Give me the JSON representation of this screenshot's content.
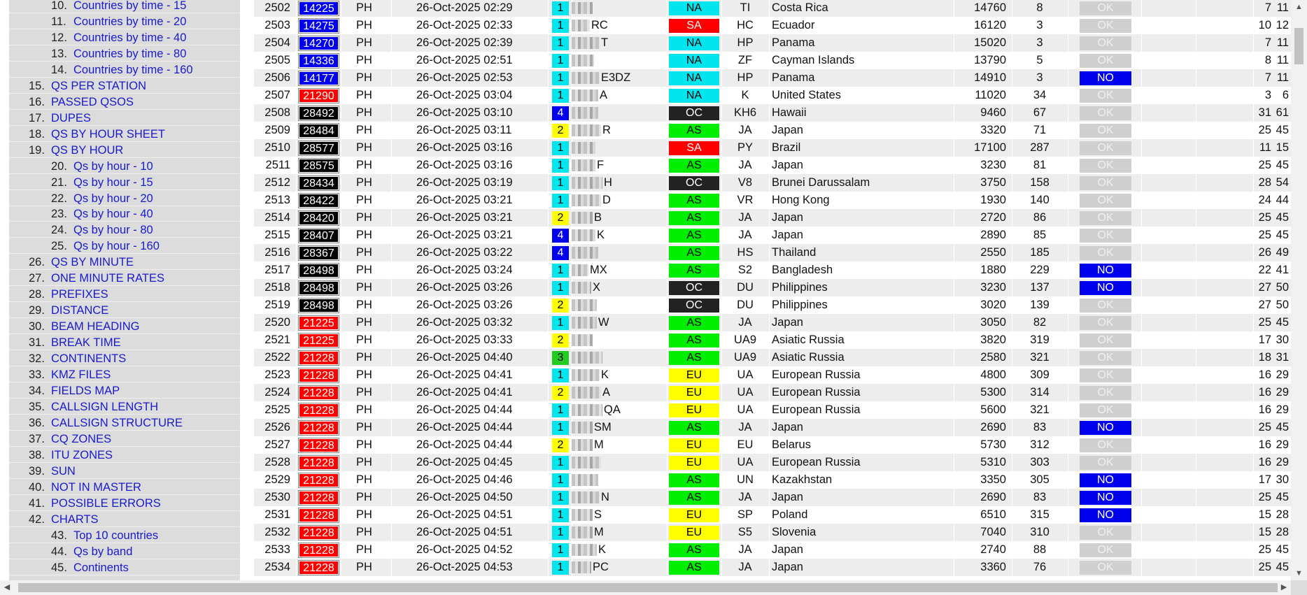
{
  "sidebar": {
    "items": [
      {
        "num": "10.",
        "label": "Countries by time - 15",
        "indent": true
      },
      {
        "num": "11.",
        "label": "Countries by time - 20",
        "indent": true
      },
      {
        "num": "12.",
        "label": "Countries by time - 40",
        "indent": true
      },
      {
        "num": "13.",
        "label": "Countries by time - 80",
        "indent": true
      },
      {
        "num": "14.",
        "label": "Countries by time - 160",
        "indent": true
      },
      {
        "num": "15.",
        "label": "QS PER STATION",
        "indent": false
      },
      {
        "num": "16.",
        "label": "PASSED QSOS",
        "indent": false
      },
      {
        "num": "17.",
        "label": "DUPES",
        "indent": false
      },
      {
        "num": "18.",
        "label": "QS BY HOUR SHEET",
        "indent": false
      },
      {
        "num": "19.",
        "label": "QS BY HOUR",
        "indent": false
      },
      {
        "num": "20.",
        "label": "Qs by hour - 10",
        "indent": true
      },
      {
        "num": "21.",
        "label": "Qs by hour - 15",
        "indent": true
      },
      {
        "num": "22.",
        "label": "Qs by hour - 20",
        "indent": true
      },
      {
        "num": "23.",
        "label": "Qs by hour - 40",
        "indent": true
      },
      {
        "num": "24.",
        "label": "Qs by hour - 80",
        "indent": true
      },
      {
        "num": "25.",
        "label": "Qs by hour - 160",
        "indent": true
      },
      {
        "num": "26.",
        "label": "QS BY MINUTE",
        "indent": false
      },
      {
        "num": "27.",
        "label": "ONE MINUTE RATES",
        "indent": false
      },
      {
        "num": "28.",
        "label": "PREFIXES",
        "indent": false
      },
      {
        "num": "29.",
        "label": "DISTANCE",
        "indent": false
      },
      {
        "num": "30.",
        "label": "BEAM HEADING",
        "indent": false
      },
      {
        "num": "31.",
        "label": "BREAK TIME",
        "indent": false
      },
      {
        "num": "32.",
        "label": "CONTINENTS",
        "indent": false
      },
      {
        "num": "33.",
        "label": "KMZ FILES",
        "indent": false
      },
      {
        "num": "34.",
        "label": "FIELDS MAP",
        "indent": false
      },
      {
        "num": "35.",
        "label": "CALLSIGN LENGTH",
        "indent": false
      },
      {
        "num": "36.",
        "label": "CALLSIGN STRUCTURE",
        "indent": false
      },
      {
        "num": "37.",
        "label": "CQ ZONES",
        "indent": false
      },
      {
        "num": "38.",
        "label": "ITU ZONES",
        "indent": false
      },
      {
        "num": "39.",
        "label": "SUN",
        "indent": false
      },
      {
        "num": "40.",
        "label": "NOT IN MASTER",
        "indent": false
      },
      {
        "num": "41.",
        "label": "POSSIBLE ERRORS",
        "indent": false
      },
      {
        "num": "42.",
        "label": "CHARTS",
        "indent": false
      },
      {
        "num": "43.",
        "label": "Top 10 countries",
        "indent": true
      },
      {
        "num": "44.",
        "label": "Qs by band",
        "indent": true
      },
      {
        "num": "45.",
        "label": "Continents",
        "indent": true
      }
    ]
  },
  "colors": {
    "tx": {
      "blue": "#0000ee",
      "red": "#ff0000",
      "black": "#000000"
    },
    "op": {
      "1": "#00e5ee",
      "2": "#ffff00",
      "3": "#22cc22",
      "4": "#0000ee"
    },
    "cont": {
      "NA": "#00e5ee",
      "SA": "#ff0000",
      "OC": "#222222",
      "AS": "#00ee00",
      "EU": "#ffff00"
    },
    "status": {
      "OK": "#cfcfcf",
      "NO": "#0000ee"
    }
  },
  "table": {
    "rows": [
      {
        "n": "2502",
        "freq": "14225",
        "txc": "blue",
        "mode": "PH",
        "dt": "26-Oct-2025 02:29",
        "op": "1",
        "call": "",
        "cont": "NA",
        "pfx": "TI",
        "country": "Costa Rica",
        "dist": "14760",
        "head": "8",
        "status": "OK",
        "cq": "7",
        "itu": "11"
      },
      {
        "n": "2503",
        "freq": "14275",
        "txc": "blue",
        "mode": "PH",
        "dt": "26-Oct-2025 02:33",
        "op": "1",
        "call": "RC",
        "cont": "SA",
        "pfx": "HC",
        "country": "Ecuador",
        "dist": "16120",
        "head": "3",
        "status": "OK",
        "cq": "10",
        "itu": "12"
      },
      {
        "n": "2504",
        "freq": "14270",
        "txc": "blue",
        "mode": "PH",
        "dt": "26-Oct-2025 02:39",
        "op": "1",
        "call": "T",
        "cont": "NA",
        "pfx": "HP",
        "country": "Panama",
        "dist": "15020",
        "head": "3",
        "status": "OK",
        "cq": "7",
        "itu": "11"
      },
      {
        "n": "2505",
        "freq": "14336",
        "txc": "blue",
        "mode": "PH",
        "dt": "26-Oct-2025 02:51",
        "op": "1",
        "call": "",
        "cont": "NA",
        "pfx": "ZF",
        "country": "Cayman Islands",
        "dist": "13790",
        "head": "5",
        "status": "OK",
        "cq": "8",
        "itu": "11"
      },
      {
        "n": "2506",
        "freq": "14177",
        "txc": "blue",
        "mode": "PH",
        "dt": "26-Oct-2025 02:53",
        "op": "1",
        "call": "E3DZ",
        "cont": "NA",
        "pfx": "HP",
        "country": "Panama",
        "dist": "14910",
        "head": "3",
        "status": "NO",
        "cq": "7",
        "itu": "11"
      },
      {
        "n": "2507",
        "freq": "21290",
        "txc": "red",
        "mode": "PH",
        "dt": "26-Oct-2025 03:04",
        "op": "1",
        "call": "A",
        "cont": "NA",
        "pfx": "K",
        "country": "United States",
        "dist": "11020",
        "head": "34",
        "status": "OK",
        "cq": "3",
        "itu": "6"
      },
      {
        "n": "2508",
        "freq": "28492",
        "txc": "black",
        "mode": "PH",
        "dt": "26-Oct-2025 03:10",
        "op": "4",
        "call": "",
        "cont": "OC",
        "pfx": "KH6",
        "country": "Hawaii",
        "dist": "9460",
        "head": "67",
        "status": "OK",
        "cq": "31",
        "itu": "61"
      },
      {
        "n": "2509",
        "freq": "28484",
        "txc": "black",
        "mode": "PH",
        "dt": "26-Oct-2025 03:11",
        "op": "2",
        "call": "R",
        "cont": "AS",
        "pfx": "JA",
        "country": "Japan",
        "dist": "3320",
        "head": "71",
        "status": "OK",
        "cq": "25",
        "itu": "45"
      },
      {
        "n": "2510",
        "freq": "28577",
        "txc": "black",
        "mode": "PH",
        "dt": "26-Oct-2025 03:16",
        "op": "1",
        "call": "",
        "cont": "SA",
        "pfx": "PY",
        "country": "Brazil",
        "dist": "17100",
        "head": "287",
        "status": "OK",
        "cq": "11",
        "itu": "15"
      },
      {
        "n": "2511",
        "freq": "28575",
        "txc": "black",
        "mode": "PH",
        "dt": "26-Oct-2025 03:16",
        "op": "1",
        "call": "F",
        "cont": "AS",
        "pfx": "JA",
        "country": "Japan",
        "dist": "3230",
        "head": "81",
        "status": "OK",
        "cq": "25",
        "itu": "45"
      },
      {
        "n": "2512",
        "freq": "28434",
        "txc": "black",
        "mode": "PH",
        "dt": "26-Oct-2025 03:19",
        "op": "1",
        "call": "H",
        "cont": "OC",
        "pfx": "V8",
        "country": "Brunei Darussalam",
        "dist": "3750",
        "head": "158",
        "status": "OK",
        "cq": "28",
        "itu": "54"
      },
      {
        "n": "2513",
        "freq": "28422",
        "txc": "black",
        "mode": "PH",
        "dt": "26-Oct-2025 03:21",
        "op": "1",
        "call": "D",
        "cont": "AS",
        "pfx": "VR",
        "country": "Hong Kong",
        "dist": "1930",
        "head": "140",
        "status": "OK",
        "cq": "24",
        "itu": "44"
      },
      {
        "n": "2514",
        "freq": "28420",
        "txc": "black",
        "mode": "PH",
        "dt": "26-Oct-2025 03:21",
        "op": "2",
        "call": "B",
        "cont": "AS",
        "pfx": "JA",
        "country": "Japan",
        "dist": "2720",
        "head": "86",
        "status": "OK",
        "cq": "25",
        "itu": "45"
      },
      {
        "n": "2515",
        "freq": "28407",
        "txc": "black",
        "mode": "PH",
        "dt": "26-Oct-2025 03:21",
        "op": "4",
        "call": "K",
        "cont": "AS",
        "pfx": "JA",
        "country": "Japan",
        "dist": "2890",
        "head": "85",
        "status": "OK",
        "cq": "25",
        "itu": "45"
      },
      {
        "n": "2516",
        "freq": "28367",
        "txc": "black",
        "mode": "PH",
        "dt": "26-Oct-2025 03:22",
        "op": "4",
        "call": "",
        "cont": "AS",
        "pfx": "HS",
        "country": "Thailand",
        "dist": "2550",
        "head": "185",
        "status": "OK",
        "cq": "26",
        "itu": "49"
      },
      {
        "n": "2517",
        "freq": "28498",
        "txc": "black",
        "mode": "PH",
        "dt": "26-Oct-2025 03:24",
        "op": "1",
        "call": "MX",
        "cont": "AS",
        "pfx": "S2",
        "country": "Bangladesh",
        "dist": "1880",
        "head": "229",
        "status": "NO",
        "cq": "22",
        "itu": "41"
      },
      {
        "n": "2518",
        "freq": "28498",
        "txc": "black",
        "mode": "PH",
        "dt": "26-Oct-2025 03:26",
        "op": "1",
        "call": "X",
        "cont": "OC",
        "pfx": "DU",
        "country": "Philippines",
        "dist": "3230",
        "head": "137",
        "status": "NO",
        "cq": "27",
        "itu": "50"
      },
      {
        "n": "2519",
        "freq": "28498",
        "txc": "black",
        "mode": "PH",
        "dt": "26-Oct-2025 03:26",
        "op": "2",
        "call": "",
        "cont": "OC",
        "pfx": "DU",
        "country": "Philippines",
        "dist": "3020",
        "head": "139",
        "status": "OK",
        "cq": "27",
        "itu": "50"
      },
      {
        "n": "2520",
        "freq": "21225",
        "txc": "red",
        "mode": "PH",
        "dt": "26-Oct-2025 03:32",
        "op": "1",
        "call": "W",
        "cont": "AS",
        "pfx": "JA",
        "country": "Japan",
        "dist": "3050",
        "head": "82",
        "status": "OK",
        "cq": "25",
        "itu": "45"
      },
      {
        "n": "2521",
        "freq": "21225",
        "txc": "red",
        "mode": "PH",
        "dt": "26-Oct-2025 03:33",
        "op": "2",
        "call": "",
        "cont": "AS",
        "pfx": "UA9",
        "country": "Asiatic Russia",
        "dist": "3820",
        "head": "319",
        "status": "OK",
        "cq": "17",
        "itu": "30"
      },
      {
        "n": "2522",
        "freq": "21228",
        "txc": "red",
        "mode": "PH",
        "dt": "26-Oct-2025 04:40",
        "op": "3",
        "call": "",
        "cont": "AS",
        "pfx": "UA9",
        "country": "Asiatic Russia",
        "dist": "2580",
        "head": "321",
        "status": "OK",
        "cq": "18",
        "itu": "31"
      },
      {
        "n": "2523",
        "freq": "21228",
        "txc": "red",
        "mode": "PH",
        "dt": "26-Oct-2025 04:41",
        "op": "1",
        "call": "K",
        "cont": "EU",
        "pfx": "UA",
        "country": "European Russia",
        "dist": "4800",
        "head": "309",
        "status": "OK",
        "cq": "16",
        "itu": "29"
      },
      {
        "n": "2524",
        "freq": "21228",
        "txc": "red",
        "mode": "PH",
        "dt": "26-Oct-2025 04:41",
        "op": "2",
        "call": "A",
        "cont": "EU",
        "pfx": "UA",
        "country": "European Russia",
        "dist": "5300",
        "head": "314",
        "status": "OK",
        "cq": "16",
        "itu": "29"
      },
      {
        "n": "2525",
        "freq": "21228",
        "txc": "red",
        "mode": "PH",
        "dt": "26-Oct-2025 04:44",
        "op": "1",
        "call": "QA",
        "cont": "EU",
        "pfx": "UA",
        "country": "European Russia",
        "dist": "5600",
        "head": "321",
        "status": "OK",
        "cq": "16",
        "itu": "29"
      },
      {
        "n": "2526",
        "freq": "21228",
        "txc": "red",
        "mode": "PH",
        "dt": "26-Oct-2025 04:44",
        "op": "1",
        "call": "SM",
        "cont": "AS",
        "pfx": "JA",
        "country": "Japan",
        "dist": "2690",
        "head": "83",
        "status": "NO",
        "cq": "25",
        "itu": "45"
      },
      {
        "n": "2527",
        "freq": "21228",
        "txc": "red",
        "mode": "PH",
        "dt": "26-Oct-2025 04:44",
        "op": "2",
        "call": "M",
        "cont": "EU",
        "pfx": "EU",
        "country": "Belarus",
        "dist": "5730",
        "head": "312",
        "status": "OK",
        "cq": "16",
        "itu": "29"
      },
      {
        "n": "2528",
        "freq": "21228",
        "txc": "red",
        "mode": "PH",
        "dt": "26-Oct-2025 04:45",
        "op": "1",
        "call": "",
        "cont": "EU",
        "pfx": "UA",
        "country": "European Russia",
        "dist": "5310",
        "head": "303",
        "status": "OK",
        "cq": "16",
        "itu": "29"
      },
      {
        "n": "2529",
        "freq": "21228",
        "txc": "red",
        "mode": "PH",
        "dt": "26-Oct-2025 04:46",
        "op": "1",
        "call": "",
        "cont": "AS",
        "pfx": "UN",
        "country": "Kazakhstan",
        "dist": "3350",
        "head": "305",
        "status": "NO",
        "cq": "17",
        "itu": "30"
      },
      {
        "n": "2530",
        "freq": "21228",
        "txc": "red",
        "mode": "PH",
        "dt": "26-Oct-2025 04:50",
        "op": "1",
        "call": "N",
        "cont": "AS",
        "pfx": "JA",
        "country": "Japan",
        "dist": "2690",
        "head": "83",
        "status": "NO",
        "cq": "25",
        "itu": "45"
      },
      {
        "n": "2531",
        "freq": "21228",
        "txc": "red",
        "mode": "PH",
        "dt": "26-Oct-2025 04:51",
        "op": "1",
        "call": "S",
        "cont": "EU",
        "pfx": "SP",
        "country": "Poland",
        "dist": "6510",
        "head": "315",
        "status": "NO",
        "cq": "15",
        "itu": "28"
      },
      {
        "n": "2532",
        "freq": "21228",
        "txc": "red",
        "mode": "PH",
        "dt": "26-Oct-2025 04:51",
        "op": "1",
        "call": "M",
        "cont": "EU",
        "pfx": "S5",
        "country": "Slovenia",
        "dist": "7040",
        "head": "310",
        "status": "OK",
        "cq": "15",
        "itu": "28"
      },
      {
        "n": "2533",
        "freq": "21228",
        "txc": "red",
        "mode": "PH",
        "dt": "26-Oct-2025 04:52",
        "op": "1",
        "call": "K",
        "cont": "AS",
        "pfx": "JA",
        "country": "Japan",
        "dist": "2740",
        "head": "88",
        "status": "OK",
        "cq": "25",
        "itu": "45"
      },
      {
        "n": "2534",
        "freq": "21228",
        "txc": "red",
        "mode": "PH",
        "dt": "26-Oct-2025 04:53",
        "op": "1",
        "call": "PC",
        "cont": "AS",
        "pfx": "JA",
        "country": "Japan",
        "dist": "3360",
        "head": "76",
        "status": "OK",
        "cq": "25",
        "itu": "45"
      }
    ]
  }
}
